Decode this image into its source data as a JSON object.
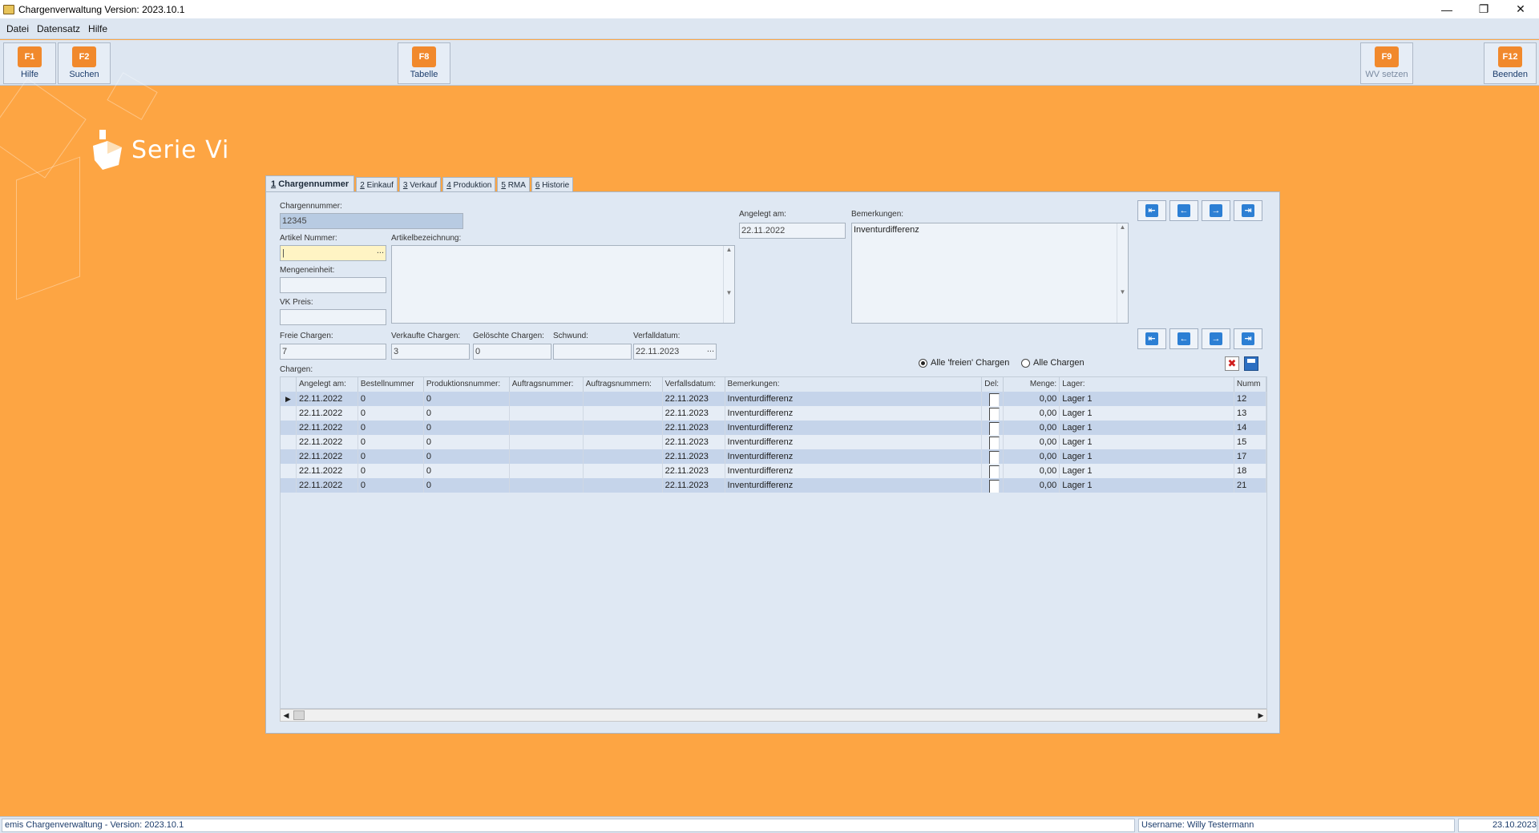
{
  "window": {
    "title": "Chargenverwaltung Version: 2023.10.1"
  },
  "menu": [
    "Datei",
    "Datensatz",
    "Hilfe"
  ],
  "toolbar": [
    {
      "key": "F1",
      "label": "Hilfe"
    },
    {
      "key": "F2",
      "label": "Suchen"
    },
    {
      "key": "F8",
      "label": "Tabelle"
    },
    {
      "key": "F9",
      "label": "WV setzen"
    },
    {
      "key": "F12",
      "label": "Beenden"
    }
  ],
  "logo": {
    "text": "Serie Vi"
  },
  "tabs": [
    {
      "num": "1",
      "label": "Chargennummer"
    },
    {
      "num": "2",
      "label": "Einkauf"
    },
    {
      "num": "3",
      "label": "Verkauf"
    },
    {
      "num": "4",
      "label": "Produktion"
    },
    {
      "num": "5",
      "label": "RMA"
    },
    {
      "num": "6",
      "label": "Historie"
    }
  ],
  "form": {
    "chargennummer_label": "Chargennummer:",
    "chargennummer": "12345",
    "artikel_nummer_label": "Artikel Nummer:",
    "artikel_nummer": "",
    "artikelbezeichnung_label": "Artikelbezeichnung:",
    "mengeneinheit_label": "Mengeneinheit:",
    "vk_preis_label": "VK Preis:",
    "angelegt_am_label": "Angelegt am:",
    "angelegt_am": "22.11.2022",
    "bemerkungen_label": "Bemerkungen:",
    "bemerkungen": "Inventurdifferenz",
    "freie_chargen_label": "Freie Chargen:",
    "freie_chargen": "7",
    "verkaufte_chargen_label": "Verkaufte Chargen:",
    "verkaufte_chargen": "3",
    "geloeschte_chargen_label": "Gelöschte Chargen:",
    "geloeschte_chargen": "0",
    "schwund_label": "Schwund:",
    "schwund": "",
    "verfalldatum_label": "Verfalldatum:",
    "verfalldatum": "22.11.2023",
    "chargen_label": "Chargen:",
    "dots": "..."
  },
  "filter": {
    "option_free": "Alle 'freien' Chargen",
    "option_all": "Alle Chargen"
  },
  "grid": {
    "columns": [
      "Angelegt am:",
      "Bestellnummer",
      "Produktionsnummer:",
      "Auftragsnummer:",
      "Auftragsnummern:",
      "Verfallsdatum:",
      "Bemerkungen:",
      "Del:",
      "Menge:",
      "Lager:",
      "Numm"
    ],
    "rows": [
      [
        "22.11.2022",
        "0",
        "0",
        "",
        "",
        "22.11.2023",
        "Inventurdifferenz",
        "",
        "0,00",
        "Lager 1",
        "12"
      ],
      [
        "22.11.2022",
        "0",
        "0",
        "",
        "",
        "22.11.2023",
        "Inventurdifferenz",
        "",
        "0,00",
        "Lager 1",
        "13"
      ],
      [
        "22.11.2022",
        "0",
        "0",
        "",
        "",
        "22.11.2023",
        "Inventurdifferenz",
        "",
        "0,00",
        "Lager 1",
        "14"
      ],
      [
        "22.11.2022",
        "0",
        "0",
        "",
        "",
        "22.11.2023",
        "Inventurdifferenz",
        "",
        "0,00",
        "Lager 1",
        "15"
      ],
      [
        "22.11.2022",
        "0",
        "0",
        "",
        "",
        "22.11.2023",
        "Inventurdifferenz",
        "",
        "0,00",
        "Lager 1",
        "17"
      ],
      [
        "22.11.2022",
        "0",
        "0",
        "",
        "",
        "22.11.2023",
        "Inventurdifferenz",
        "",
        "0,00",
        "Lager 1",
        "18"
      ],
      [
        "22.11.2022",
        "0",
        "0",
        "",
        "",
        "22.11.2023",
        "Inventurdifferenz",
        "",
        "0,00",
        "Lager 1",
        "21"
      ]
    ]
  },
  "status": {
    "left": "emis Chargenverwaltung - Version: 2023.10.1",
    "user": "Username: Willy Testermann",
    "date": "23.10.2023"
  },
  "colors": {
    "background": "#fda543",
    "accent": "#f1892c",
    "panel": "#dfe8f3"
  }
}
